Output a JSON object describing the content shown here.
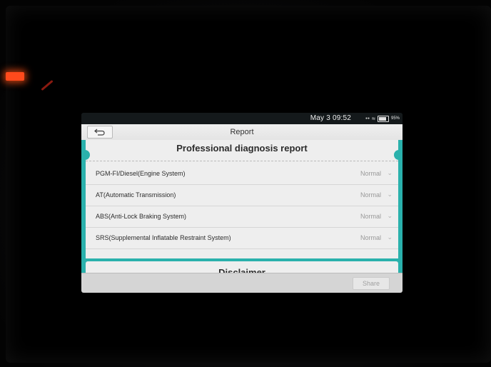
{
  "status_bar": {
    "time": "May 3   09:52",
    "battery_pct": "95%",
    "icons": [
      "network-icon",
      "wifi-icon",
      "battery-icon"
    ]
  },
  "header": {
    "title": "Report",
    "back_icon": "back-arrow-icon"
  },
  "report": {
    "heading": "Professional diagnosis report",
    "systems": [
      {
        "name": "PGM-FI/Diesel(Engine System)",
        "status": "Normal"
      },
      {
        "name": "AT(Automatic Transmission)",
        "status": "Normal"
      },
      {
        "name": "ABS(Anti-Lock Braking System)",
        "status": "Normal"
      },
      {
        "name": "SRS(Supplemental Inflatable Restraint System)",
        "status": "Normal"
      }
    ]
  },
  "disclaimer": {
    "heading": "Disclaimer"
  },
  "footer": {
    "share_label": "Share"
  },
  "colors": {
    "accent": "#2bb5b0",
    "card": "#f3f3f3",
    "status_text": "#9b9b9b"
  }
}
